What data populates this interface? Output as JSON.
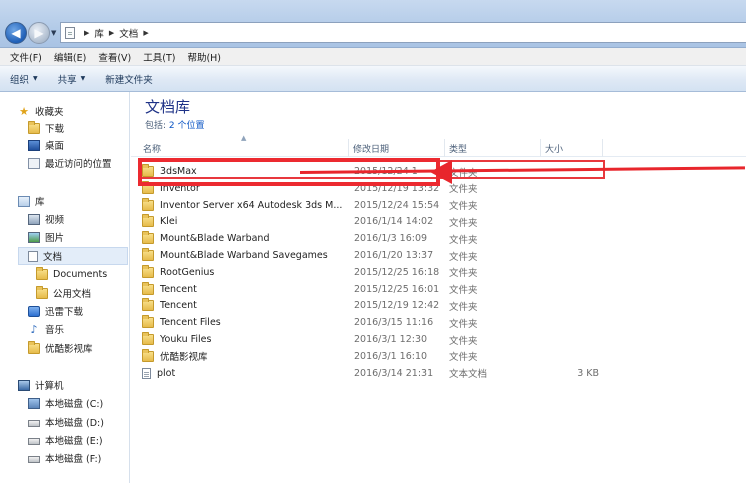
{
  "address": {
    "crumbs": [
      "库",
      "文档"
    ]
  },
  "menu": [
    "文件(F)",
    "编辑(E)",
    "查看(V)",
    "工具(T)",
    "帮助(H)"
  ],
  "toolbar": {
    "organize": "组织",
    "share": "共享",
    "new_folder": "新建文件夹"
  },
  "nav": {
    "favorites": "收藏夹",
    "downloads": "下载",
    "desktop": "桌面",
    "recent": "最近访问的位置",
    "libraries": "库",
    "videos": "视频",
    "pictures": "图片",
    "documents": "文档",
    "documents_sub": "Documents",
    "public_docs": "公用文档",
    "thunder": "迅雷下载",
    "music": "音乐",
    "youku": "优酷影视库",
    "computer": "计算机",
    "drive_c": "本地磁盘 (C:)",
    "drive_d": "本地磁盘 (D:)",
    "drive_e": "本地磁盘 (E:)",
    "drive_f": "本地磁盘 (F:)"
  },
  "library": {
    "title": "文档库",
    "includes_label": "包括:",
    "includes_link": "2 个位置"
  },
  "columns": {
    "name": "名称",
    "date": "修改日期",
    "type": "类型",
    "size": "大小"
  },
  "files": [
    {
      "name": "3dsMax",
      "date": "2015/12/24 1",
      "type": "文件夹",
      "size": "",
      "kind": "folder"
    },
    {
      "name": "Inventor",
      "date": "2015/12/19 13:32",
      "type": "文件夹",
      "size": "",
      "kind": "folder"
    },
    {
      "name": "Inventor Server x64 Autodesk 3ds M...",
      "date": "2015/12/24 15:54",
      "type": "文件夹",
      "size": "",
      "kind": "folder"
    },
    {
      "name": "Klei",
      "date": "2016/1/14 14:02",
      "type": "文件夹",
      "size": "",
      "kind": "folder"
    },
    {
      "name": "Mount&Blade Warband",
      "date": "2016/1/3 16:09",
      "type": "文件夹",
      "size": "",
      "kind": "folder"
    },
    {
      "name": "Mount&Blade Warband Savegames",
      "date": "2016/1/20 13:37",
      "type": "文件夹",
      "size": "",
      "kind": "folder"
    },
    {
      "name": "RootGenius",
      "date": "2015/12/25 16:18",
      "type": "文件夹",
      "size": "",
      "kind": "folder"
    },
    {
      "name": "Tencent",
      "date": "2015/12/25 16:01",
      "type": "文件夹",
      "size": "",
      "kind": "folder"
    },
    {
      "name": "Tencent",
      "date": "2015/12/19 12:42",
      "type": "文件夹",
      "size": "",
      "kind": "folder"
    },
    {
      "name": "Tencent Files",
      "date": "2016/3/15 11:16",
      "type": "文件夹",
      "size": "",
      "kind": "folder"
    },
    {
      "name": "Youku Files",
      "date": "2016/3/1 12:30",
      "type": "文件夹",
      "size": "",
      "kind": "folder"
    },
    {
      "name": "优酷影视库",
      "date": "2016/3/1 16:10",
      "type": "文件夹",
      "size": "",
      "kind": "folder"
    },
    {
      "name": "plot",
      "date": "2016/3/14 21:31",
      "type": "文本文档",
      "size": "3 KB",
      "kind": "text"
    }
  ],
  "colors": {
    "annotation": "#e8262c",
    "title_blue": "#1e3287",
    "link_blue": "#0b55c4"
  }
}
